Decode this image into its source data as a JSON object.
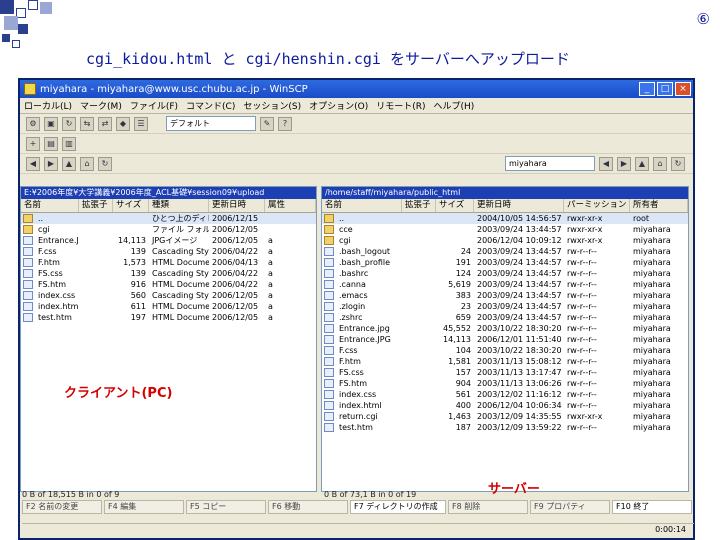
{
  "slide": {
    "title": "cgi_kidou.html と cgi/henshin.cgi をサーバーへアップロード",
    "number": "⑥",
    "pc_label": "クライアント(PC)",
    "server_label": "サーバー"
  },
  "window": {
    "title": "miyahara - miyahara@www.usc.chubu.ac.jp - WinSCP",
    "menu": [
      "ローカル(L)",
      "マーク(M)",
      "ファイル(F)",
      "コマンド(C)",
      "セッション(S)",
      "オプション(O)",
      "リモート(R)",
      "ヘルプ(H)"
    ],
    "transfer_setting": "デフォルト"
  },
  "local": {
    "path": "E:¥2006年度¥大学講義¥2006年度_ACL基礎¥session09¥upload",
    "columns": [
      "名前",
      "拡張子",
      "サイズ",
      "種類",
      "更新日時",
      "属性"
    ],
    "rows": [
      {
        "name": "..",
        "ext": "",
        "size": "",
        "type": "ひとつ上のディレクトリ",
        "date": "2006/12/15",
        "attr": "",
        "folder": true
      },
      {
        "name": "cgi",
        "ext": "",
        "size": "",
        "type": "ファイル フォルダ",
        "date": "2006/12/05",
        "attr": "",
        "folder": true
      },
      {
        "name": "Entrance.JPG",
        "ext": "",
        "size": "14,113",
        "type": "JPGイメージ",
        "date": "2006/12/05",
        "attr": "a",
        "folder": false
      },
      {
        "name": "F.css",
        "ext": "",
        "size": "139",
        "type": "Cascading Style...",
        "date": "2006/04/22",
        "attr": "a",
        "folder": false
      },
      {
        "name": "F.htm",
        "ext": "",
        "size": "1,573",
        "type": "HTML Document",
        "date": "2006/04/13",
        "attr": "a",
        "folder": false
      },
      {
        "name": "FS.css",
        "ext": "",
        "size": "139",
        "type": "Cascading Style...",
        "date": "2006/04/22",
        "attr": "a",
        "folder": false
      },
      {
        "name": "FS.htm",
        "ext": "",
        "size": "916",
        "type": "HTML Document",
        "date": "2006/04/22",
        "attr": "a",
        "folder": false
      },
      {
        "name": "index.css",
        "ext": "",
        "size": "560",
        "type": "Cascading Style...",
        "date": "2006/12/05",
        "attr": "a",
        "folder": false
      },
      {
        "name": "index.html",
        "ext": "",
        "size": "611",
        "type": "HTML Document",
        "date": "2006/12/05",
        "attr": "a",
        "folder": false
      },
      {
        "name": "test.htm",
        "ext": "",
        "size": "197",
        "type": "HTML Document",
        "date": "2006/12/05",
        "attr": "a",
        "folder": false
      }
    ],
    "status": "0 B of 18,515 B in 0 of 9"
  },
  "remote": {
    "path": "/home/staff/miyahara/public_html",
    "dir_combo": "miyahara",
    "columns": [
      "名前",
      "拡張子",
      "サイズ",
      "更新日時",
      "パーミッション",
      "所有者"
    ],
    "rows": [
      {
        "name": "..",
        "size": "",
        "date": "2004/10/05 14:56:57",
        "perm": "rwxr-xr-x",
        "owner": "root",
        "folder": true
      },
      {
        "name": "cce",
        "size": "",
        "date": "2003/09/24 13:44:57",
        "perm": "rwxr-xr-x",
        "owner": "miyahara",
        "folder": true
      },
      {
        "name": "cgi",
        "size": "",
        "date": "2006/12/04 10:09:12",
        "perm": "rwxr-xr-x",
        "owner": "miyahara",
        "folder": true
      },
      {
        "name": ".bash_logout",
        "size": "24",
        "date": "2003/09/24 13:44:57",
        "perm": "rw-r--r--",
        "owner": "miyahara",
        "folder": false
      },
      {
        "name": ".bash_profile",
        "size": "191",
        "date": "2003/09/24 13:44:57",
        "perm": "rw-r--r--",
        "owner": "miyahara",
        "folder": false
      },
      {
        "name": ".bashrc",
        "size": "124",
        "date": "2003/09/24 13:44:57",
        "perm": "rw-r--r--",
        "owner": "miyahara",
        "folder": false
      },
      {
        "name": ".canna",
        "size": "5,619",
        "date": "2003/09/24 13:44:57",
        "perm": "rw-r--r--",
        "owner": "miyahara",
        "folder": false
      },
      {
        "name": ".emacs",
        "size": "383",
        "date": "2003/09/24 13:44:57",
        "perm": "rw-r--r--",
        "owner": "miyahara",
        "folder": false
      },
      {
        "name": ".zlogin",
        "size": "23",
        "date": "2003/09/24 13:44:57",
        "perm": "rw-r--r--",
        "owner": "miyahara",
        "folder": false
      },
      {
        "name": ".zshrc",
        "size": "659",
        "date": "2003/09/24 13:44:57",
        "perm": "rw-r--r--",
        "owner": "miyahara",
        "folder": false
      },
      {
        "name": "Entrance.jpg",
        "size": "45,552",
        "date": "2003/10/22 18:30:20",
        "perm": "rw-r--r--",
        "owner": "miyahara",
        "folder": false
      },
      {
        "name": "Entrance.JPG",
        "size": "14,113",
        "date": "2006/12/01 11:51:40",
        "perm": "rw-r--r--",
        "owner": "miyahara",
        "folder": false
      },
      {
        "name": "F.css",
        "size": "104",
        "date": "2003/10/22 18:30:20",
        "perm": "rw-r--r--",
        "owner": "miyahara",
        "folder": false
      },
      {
        "name": "F.htm",
        "size": "1,581",
        "date": "2003/11/13 15:08:12",
        "perm": "rw-r--r--",
        "owner": "miyahara",
        "folder": false
      },
      {
        "name": "FS.css",
        "size": "157",
        "date": "2003/11/13 13:17:47",
        "perm": "rw-r--r--",
        "owner": "miyahara",
        "folder": false
      },
      {
        "name": "FS.htm",
        "size": "904",
        "date": "2003/11/13 13:06:26",
        "perm": "rw-r--r--",
        "owner": "miyahara",
        "folder": false
      },
      {
        "name": "index.css",
        "size": "561",
        "date": "2003/12/02 11:16:12",
        "perm": "rw-r--r--",
        "owner": "miyahara",
        "folder": false
      },
      {
        "name": "index.html",
        "size": "400",
        "date": "2006/12/04 10:06:34",
        "perm": "rw-r--r--",
        "owner": "miyahara",
        "folder": false
      },
      {
        "name": "return.cgi",
        "size": "1,463",
        "date": "2003/12/09 14:35:55",
        "perm": "rwxr-xr-x",
        "owner": "miyahara",
        "folder": false
      },
      {
        "name": "test.htm",
        "size": "187",
        "date": "2003/12/09 13:59:22",
        "perm": "rw-r--r--",
        "owner": "miyahara",
        "folder": false
      }
    ],
    "status": "0 B of 73,1 B in 0 of 19"
  },
  "fkeys": [
    "F2 名前の変更",
    "F4 編集",
    "F5 コピー",
    "F6 移動",
    "F7 ディレクトリの作成",
    "F8 削除",
    "F9 プロパティ",
    "F10 終了"
  ],
  "statusbar": "0:00:14"
}
